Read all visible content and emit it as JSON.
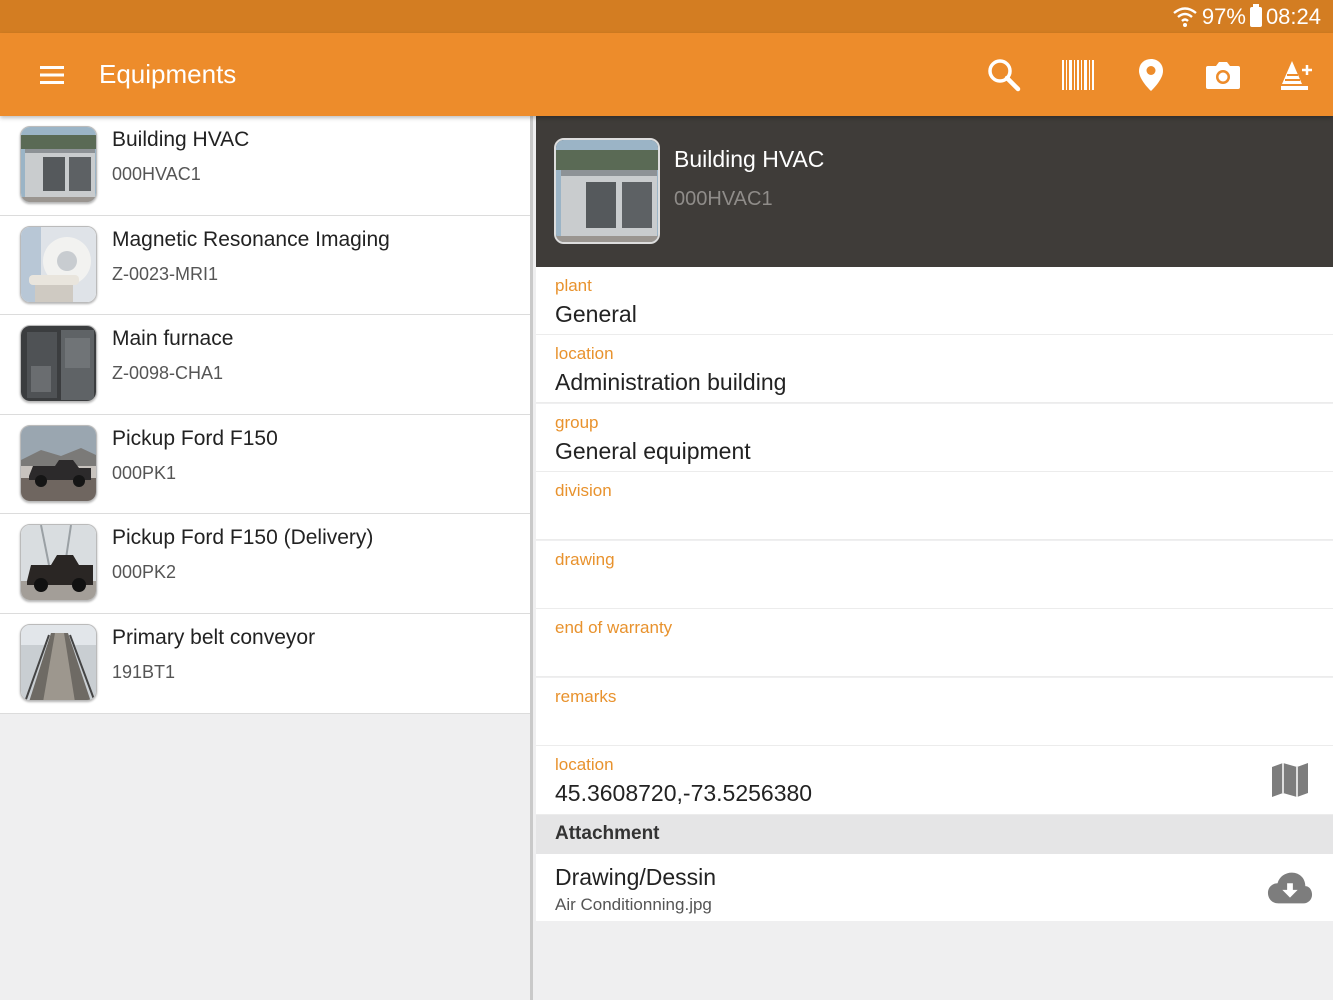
{
  "status_bar": {
    "battery": "97%",
    "time": "08:24"
  },
  "app_bar": {
    "title": "Equipments",
    "actions": [
      "search-icon",
      "barcode-icon",
      "location-pin-icon",
      "camera-icon",
      "add-alert-icon"
    ]
  },
  "equipment_list": [
    {
      "name": "Building HVAC",
      "code": "000HVAC1"
    },
    {
      "name": "Magnetic Resonance Imaging",
      "code": "Z-0023-MRI1"
    },
    {
      "name": "Main furnace",
      "code": "Z-0098-CHA1"
    },
    {
      "name": "Pickup Ford F150",
      "code": "000PK1"
    },
    {
      "name": "Pickup Ford F150 (Delivery)",
      "code": "000PK2"
    },
    {
      "name": "Primary belt conveyor",
      "code": "191BT1"
    }
  ],
  "detail": {
    "title": "Building HVAC",
    "code": "000HVAC1",
    "fields": [
      {
        "label": "plant",
        "value": "General"
      },
      {
        "label": "location",
        "value": "Administration building"
      },
      {
        "label": "group",
        "value": "General equipment"
      },
      {
        "label": "division",
        "value": ""
      },
      {
        "label": "drawing",
        "value": ""
      },
      {
        "label": "end of warranty",
        "value": ""
      },
      {
        "label": "remarks",
        "value": ""
      },
      {
        "label": "location",
        "value": "45.3608720,-73.5256380"
      }
    ],
    "attachment_section": "Attachment",
    "attachment": {
      "name": "Drawing/Dessin",
      "file": "Air Conditionning.jpg"
    }
  },
  "colors": {
    "accent": "#ed8c2b",
    "status_bar": "#d37d22",
    "label": "#e8922d",
    "header_dark": "#3f3c39"
  }
}
